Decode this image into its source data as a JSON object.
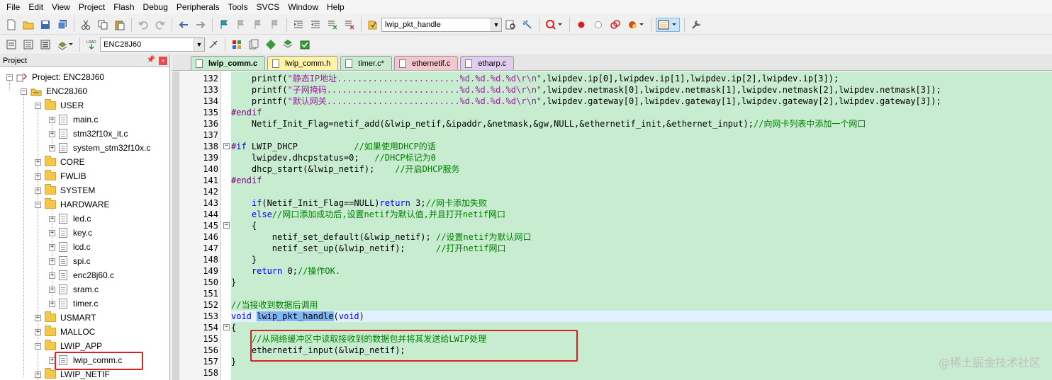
{
  "menu": [
    "File",
    "Edit",
    "View",
    "Project",
    "Flash",
    "Debug",
    "Peripherals",
    "Tools",
    "SVCS",
    "Window",
    "Help"
  ],
  "toolbar": {
    "find_combo_value": "lwip_pkt_handle",
    "target_combo_value": "ENC28J60"
  },
  "project_panel": {
    "title": "Project",
    "root": "Project: ENC28J60",
    "target": "ENC28J60",
    "items": [
      {
        "label": "USER",
        "type": "folder",
        "expanded": true
      },
      {
        "label": "main.c",
        "type": "file"
      },
      {
        "label": "stm32f10x_it.c",
        "type": "file"
      },
      {
        "label": "system_stm32f10x.c",
        "type": "file"
      },
      {
        "label": "CORE",
        "type": "folder",
        "expanded": false
      },
      {
        "label": "FWLIB",
        "type": "folder",
        "expanded": false
      },
      {
        "label": "SYSTEM",
        "type": "folder",
        "expanded": false
      },
      {
        "label": "HARDWARE",
        "type": "folder",
        "expanded": true
      },
      {
        "label": "led.c",
        "type": "file"
      },
      {
        "label": "key.c",
        "type": "file"
      },
      {
        "label": "lcd.c",
        "type": "file"
      },
      {
        "label": "spi.c",
        "type": "file"
      },
      {
        "label": "enc28j60.c",
        "type": "file"
      },
      {
        "label": "sram.c",
        "type": "file"
      },
      {
        "label": "timer.c",
        "type": "file"
      },
      {
        "label": "USMART",
        "type": "folder",
        "expanded": false
      },
      {
        "label": "MALLOC",
        "type": "folder",
        "expanded": false
      },
      {
        "label": "LWIP_APP",
        "type": "folder",
        "expanded": true
      },
      {
        "label": "lwip_comm.c",
        "type": "file"
      },
      {
        "label": "LWIP_NETIF",
        "type": "folder",
        "expanded": false
      }
    ]
  },
  "tabs": [
    {
      "label": "lwip_comm.c",
      "color": "#c7eccf",
      "active": true
    },
    {
      "label": "lwip_comm.h",
      "color": "#fff3a8",
      "active": false
    },
    {
      "label": "timer.c*",
      "color": "#c7eccf",
      "active": false
    },
    {
      "label": "ethernetif.c",
      "color": "#f5c6cf",
      "active": false
    },
    {
      "label": "etharp.c",
      "color": "#e2cdf0",
      "active": false
    }
  ],
  "code_lines": [
    {
      "n": "132",
      "t": "    printf(\"静态IP地址........................%d.%d.%d.%d\\r\\n\",lwipdev.ip[0],lwipdev.ip[1],lwipdev.ip[2],lwipdev.ip[3]);"
    },
    {
      "n": "133",
      "t": "    printf(\"子网掩码..........................%d.%d.%d.%d\\r\\n\",lwipdev.netmask[0],lwipdev.netmask[1],lwipdev.netmask[2],lwipdev.netmask[3]);"
    },
    {
      "n": "134",
      "t": "    printf(\"默认网关..........................%d.%d.%d.%d\\r\\n\",lwipdev.gateway[0],lwipdev.gateway[1],lwipdev.gateway[2],lwipdev.gateway[3]);"
    },
    {
      "n": "135",
      "t": "#endif"
    },
    {
      "n": "136",
      "t": "    Netif_Init_Flag=netif_add(&lwip_netif,&ipaddr,&netmask,&gw,NULL,&ethernetif_init,&ethernet_input);//向网卡列表中添加一个网口"
    },
    {
      "n": "137",
      "t": ""
    },
    {
      "n": "138",
      "t": "#if LWIP_DHCP           //如果使用DHCP的话"
    },
    {
      "n": "139",
      "t": "    lwipdev.dhcpstatus=0;   //DHCP标记为0"
    },
    {
      "n": "140",
      "t": "    dhcp_start(&lwip_netif);    //开启DHCP服务"
    },
    {
      "n": "141",
      "t": "#endif"
    },
    {
      "n": "142",
      "t": ""
    },
    {
      "n": "143",
      "t": "    if(Netif_Init_Flag==NULL)return 3;//网卡添加失败"
    },
    {
      "n": "144",
      "t": "    else//网口添加成功后,设置netif为默认值,并且打开netif网口"
    },
    {
      "n": "145",
      "t": "    {"
    },
    {
      "n": "146",
      "t": "        netif_set_default(&lwip_netif); //设置netif为默认网口"
    },
    {
      "n": "147",
      "t": "        netif_set_up(&lwip_netif);      //打开netif网口"
    },
    {
      "n": "148",
      "t": "    }"
    },
    {
      "n": "149",
      "t": "    return 0;//操作OK."
    },
    {
      "n": "150",
      "t": "}"
    },
    {
      "n": "151",
      "t": ""
    },
    {
      "n": "152",
      "t": "//当接收到数据后调用"
    },
    {
      "n": "153",
      "t": "void lwip_pkt_handle(void)"
    },
    {
      "n": "154",
      "t": "{"
    },
    {
      "n": "155",
      "t": "    //从网络缓冲区中读取接收到的数据包并将其发送给LWIP处理"
    },
    {
      "n": "156",
      "t": "    ethernetif_input(&lwip_netif);"
    },
    {
      "n": "157",
      "t": "}"
    },
    {
      "n": "158",
      "t": ""
    }
  ],
  "watermark": "@稀土掘金技术社区"
}
